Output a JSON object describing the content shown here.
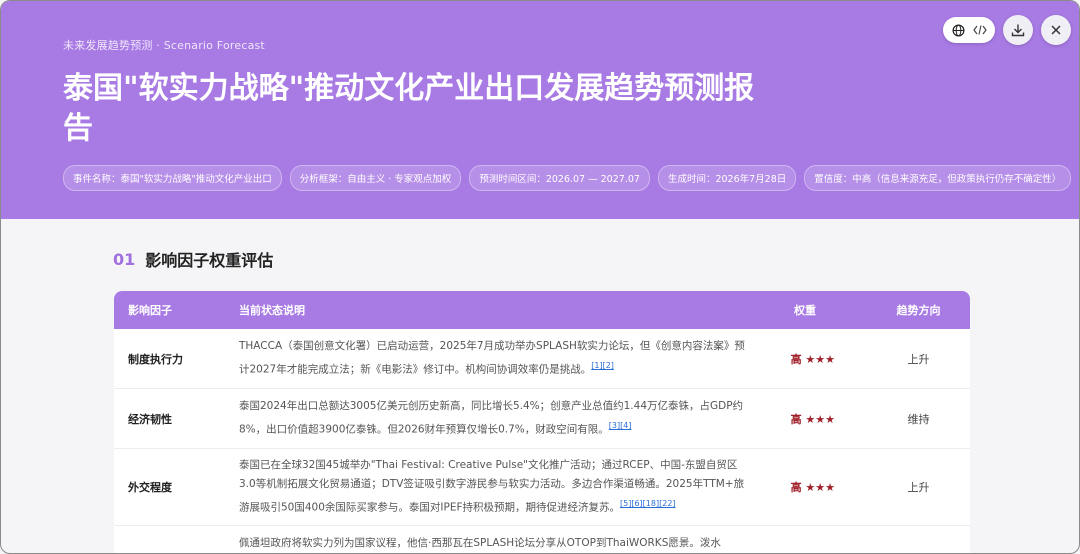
{
  "header": {
    "eyebrow": "未来发展趋势预测 · Scenario Forecast",
    "title": "泰国\"软实力战略\"推动文化产业出口发展趋势预测报告",
    "pills": [
      "事件名称：泰国\"软实力战略\"推动文化产业出口",
      "分析框架：自由主义 · 专家观点加权",
      "预测时间区间：2026.07 — 2027.07",
      "生成时间：2026年7月28日",
      "置信度：中高（信息来源充足，但政策执行仍存不确定性）"
    ]
  },
  "toolbar": {
    "globe_icon": "globe-icon",
    "code_icon": "code-icon",
    "download_icon": "download-icon",
    "close_icon": "close-icon"
  },
  "section": {
    "number": "01",
    "title": "影响因子权重评估"
  },
  "table": {
    "headers": [
      "影响因子",
      "当前状态说明",
      "权重",
      "趋势方向"
    ],
    "rows": [
      {
        "factor": "制度执行力",
        "desc": "THACCA（泰国创意文化署）已启动运营，2025年7月成功举办SPLASH软实力论坛，但《创意内容法案》预计2027年才能完成立法；新《电影法》修订中。机构间协调效率仍是挑战。",
        "refs": "[1][2]",
        "weight": "高 ★★★",
        "trend": "上升"
      },
      {
        "factor": "经济韧性",
        "desc": "泰国2024年出口总额达3005亿美元创历史新高，同比增长5.4%；创意产业总值约1.44万亿泰铢，占GDP约8%，出口价值超3900亿泰铢。但2026财年预算仅增长0.7%，财政空间有限。",
        "refs": "[3][4]",
        "weight": "高 ★★★",
        "trend": "维持"
      },
      {
        "factor": "外交程度",
        "desc": "泰国已在全球32国45城举办\"Thai Festival: Creative Pulse\"文化推广活动；通过RCEP、中国-东盟自贸区3.0等机制拓展文化贸易通道；DTV签证吸引数字游民参与软实力活动。多边合作渠道畅通。2025年TTM+旅游展吸引50国400余国际买家参与。泰国对IPEF持积极预期，期待促进经济复苏。",
        "refs": "[5][6][18][22]",
        "weight": "高 ★★★",
        "trend": "上升"
      },
      {
        "factor": "",
        "desc": "佩通坦政府将软实力列为国家议程，他信·西那瓦在SPLASH论坛分享从OTOP到ThaiWORKS愿景。泼水",
        "refs": "",
        "weight": "",
        "trend": ""
      }
    ]
  }
}
